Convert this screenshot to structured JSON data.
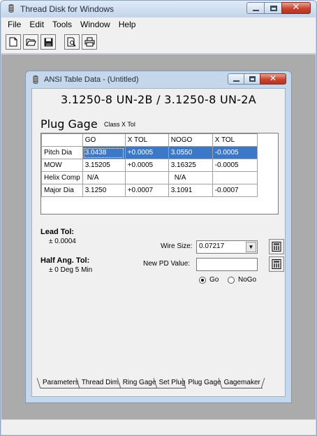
{
  "app": {
    "title": "Thread Disk for Windows",
    "menu": [
      "File",
      "Edit",
      "Tools",
      "Window",
      "Help"
    ],
    "toolbar": [
      "new-icon",
      "open-icon",
      "save-icon",
      "print-preview-icon",
      "print-icon"
    ]
  },
  "child": {
    "title": "ANSI Table Data - (Untitled)",
    "heading": "3.1250-8 UN-2B  /  3.1250-8 UN-2A",
    "gage_label": "Plug Gage",
    "class_label": "Class X Tol",
    "grid": {
      "headers": [
        "",
        "GO",
        "X TOL",
        "NOGO",
        "X TOL"
      ],
      "rows": [
        [
          "Pitch Dia",
          "3.0438",
          "+0.0005",
          "3.0550",
          "-0.0005"
        ],
        [
          "MOW",
          "3.15205",
          "+0.0005",
          "3.16325",
          "-0.0005"
        ],
        [
          "Helix Comp",
          "N/A",
          "",
          "N/A",
          ""
        ],
        [
          "Major Dia",
          "3.1250",
          "+0.0007",
          "3.1091",
          "-0.0007"
        ]
      ]
    },
    "lead_tol_label": "Lead Tol:",
    "lead_tol_value": "± 0.0004",
    "half_ang_label": "Half Ang. Tol:",
    "half_ang_value": "± 0 Deg  5 Min",
    "wire_size_label": "Wire Size:",
    "wire_size_value": "0.07217",
    "new_pd_label": "New PD Value:",
    "new_pd_value": "",
    "radio_go": "Go",
    "radio_nogo": "NoGo",
    "radio_selected": "Go",
    "tabs": [
      "Parameters",
      "Thread Dim.",
      "Ring Gage",
      "Set Plug",
      "Plug Gage",
      "Gagemaker"
    ],
    "active_tab": "Plug Gage"
  }
}
